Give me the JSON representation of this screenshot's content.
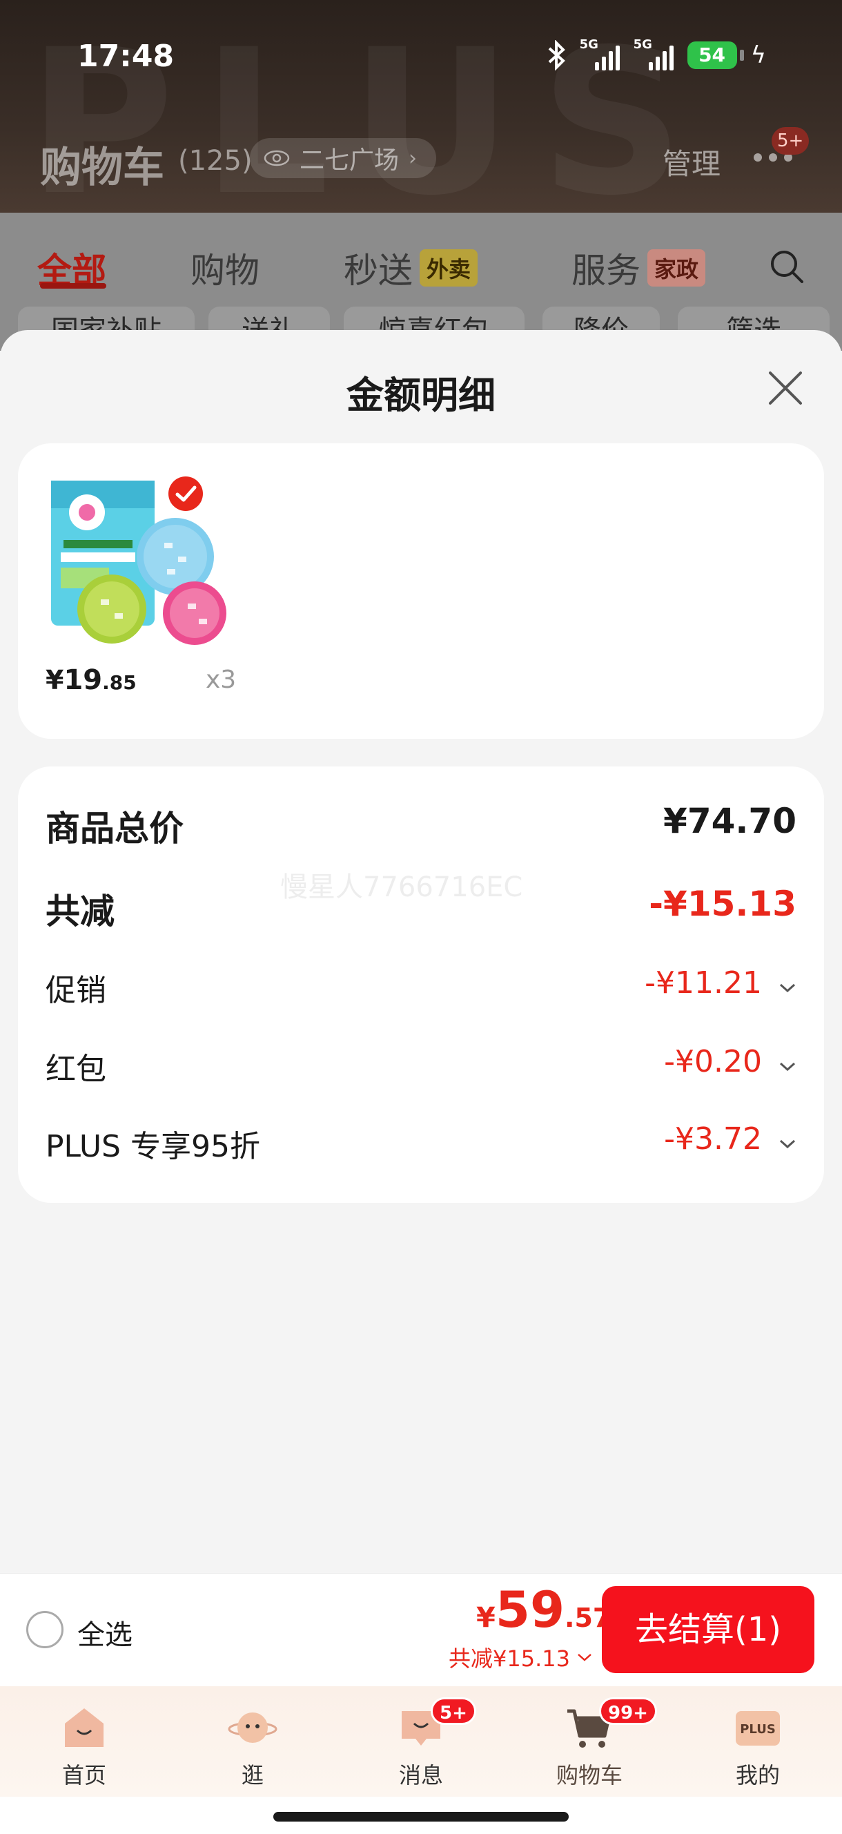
{
  "status_bar": {
    "time": "17:48",
    "network_1": "5G",
    "network_2": "5G",
    "battery": "54",
    "icons": [
      "bluetooth-icon",
      "signal-icon",
      "battery-icon",
      "charging-icon"
    ]
  },
  "header": {
    "watermark": "PLUS",
    "title": "购物车",
    "count": "(125)",
    "location": "二七广场",
    "manage": "管理",
    "more_badge": "5+"
  },
  "category_tabs": [
    {
      "label": "全部",
      "active": true
    },
    {
      "label": "购物"
    },
    {
      "label": "秒送",
      "badge": "外卖"
    },
    {
      "label": "服务",
      "badge": "家政"
    }
  ],
  "filter_chips": [
    "国家补贴",
    "送礼",
    "惊喜红包",
    "降价",
    "筛选"
  ],
  "sheet": {
    "title": "金额明细",
    "product": {
      "price_symbol": "¥",
      "price_int": "19",
      "price_dec": ".85",
      "quantity": "x3"
    },
    "summary": {
      "total_label": "商品总价",
      "total_value": "¥74.70",
      "discount_label": "共减",
      "discount_value": "-¥15.13",
      "items": [
        {
          "label": "促销",
          "value": "-¥11.21"
        },
        {
          "label": "红包",
          "value": "-¥0.20"
        },
        {
          "label": "PLUS 专享95折",
          "value": "-¥3.72"
        }
      ],
      "watermark": "慢星人7766716EC"
    }
  },
  "checkout": {
    "select_all": "全选",
    "price_symbol": "¥",
    "price_int": "59",
    "price_dec": ".57",
    "discount_text": "共减¥15.13",
    "button": "去结算(1)"
  },
  "bottom_nav": [
    {
      "label": "首页",
      "icon": "home-icon"
    },
    {
      "label": "逛",
      "icon": "planet-face-icon"
    },
    {
      "label": "消息",
      "icon": "message-icon",
      "badge": "5+"
    },
    {
      "label": "购物车",
      "icon": "cart-icon",
      "badge": "99+",
      "active": true
    },
    {
      "label": "我的",
      "icon": "plus-member-icon",
      "icon_text": "PLUS"
    }
  ],
  "colors": {
    "accent_red": "#e8271b",
    "checkout_red": "#f5121d",
    "battery_green": "#2fc24a"
  }
}
